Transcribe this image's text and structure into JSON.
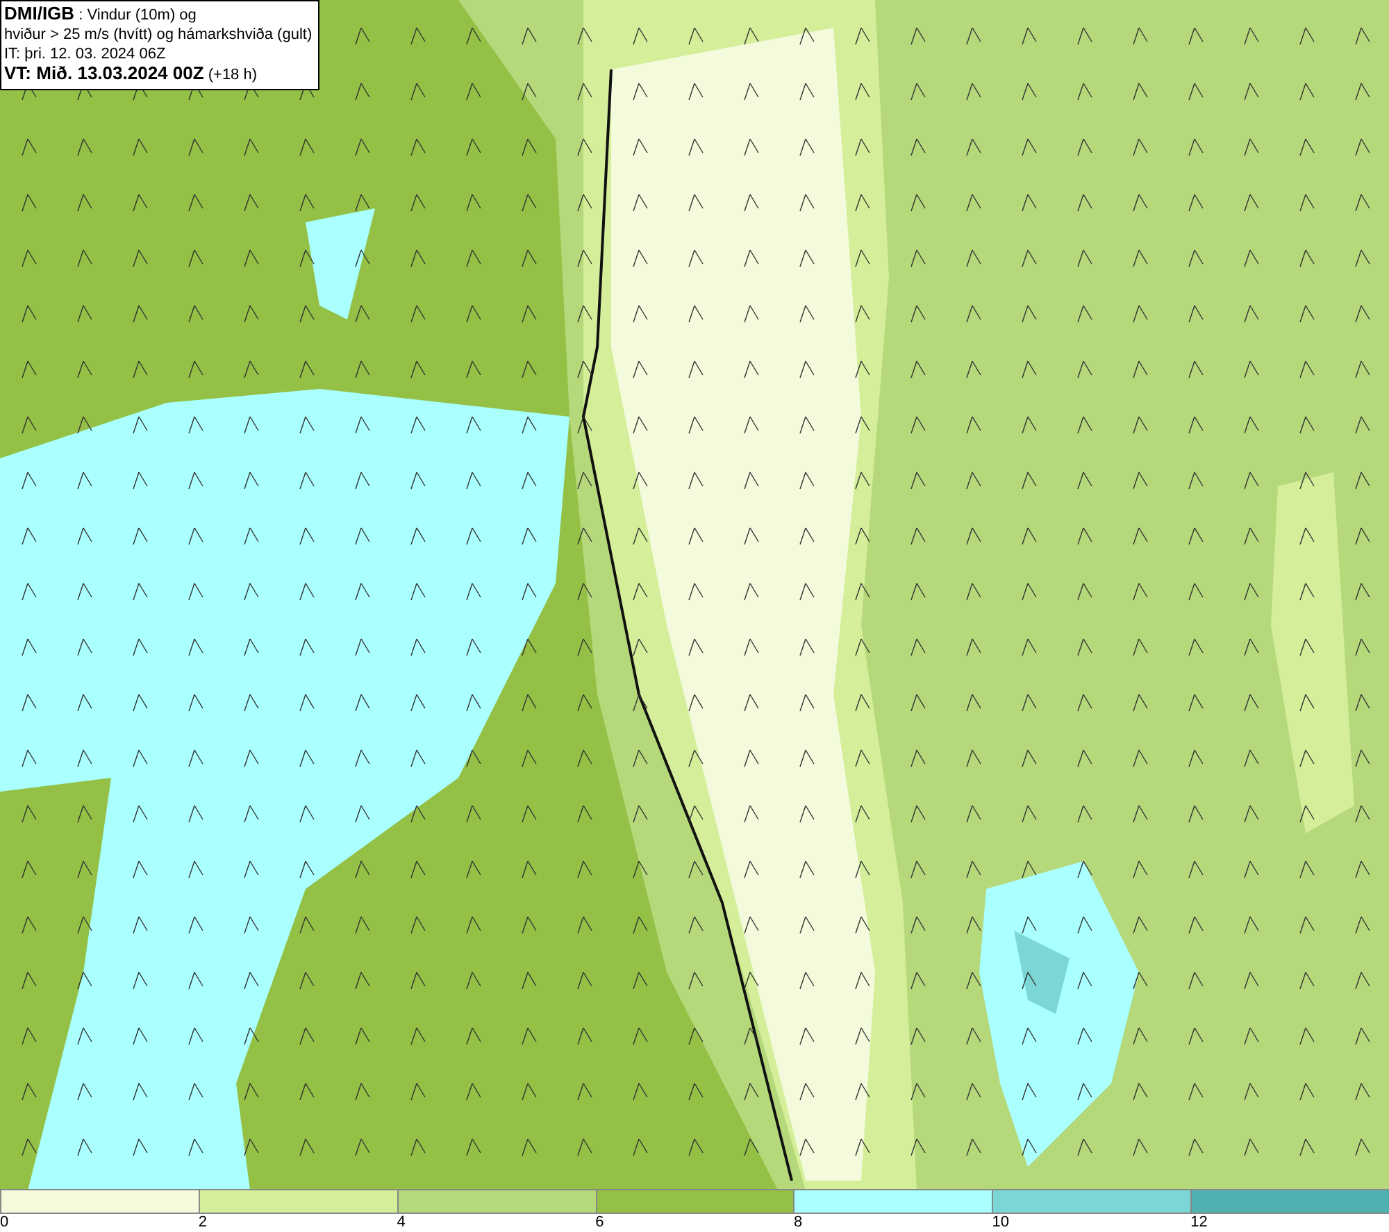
{
  "legend": {
    "lines": [
      "**DMI/IGB** : Vindur (10m) og",
      "hviður > 25 m/s (hvítt) og hámarkshviða (gult)",
      "IT: þri. 12. 03. 2024 06Z",
      "**VT: Mið. 13.03.2024 00Z** (+18 h)"
    ]
  },
  "color_scale": {
    "segments": [
      {
        "color": "#f4fbdc"
      },
      {
        "color": "#d4ee9a"
      },
      {
        "color": "#b5d87a"
      },
      {
        "color": "#93c045"
      },
      {
        "color": "#aaffff"
      },
      {
        "color": "#7dd6d6"
      },
      {
        "color": "#4fb0b0"
      }
    ],
    "ticks": [
      "0",
      "2",
      "4",
      "6",
      "8",
      "10",
      "12"
    ]
  }
}
